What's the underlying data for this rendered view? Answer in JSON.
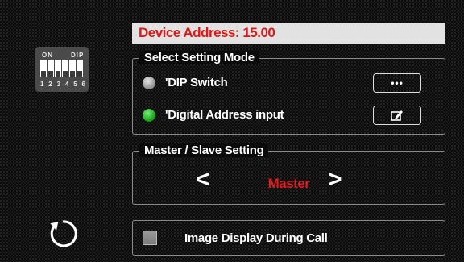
{
  "dip_widget": {
    "on_label": "ON",
    "dip_label": "DIP",
    "switch_numbers": [
      "1",
      "2",
      "3",
      "4",
      "5",
      "6"
    ]
  },
  "device_address": {
    "label": "Device Address:",
    "value": "15.00",
    "text": "Device Address:  15.00"
  },
  "setting_mode": {
    "legend": "Select Setting Mode",
    "options": [
      {
        "label": "'DIP Switch",
        "selected": false,
        "button_glyph": "•••",
        "button_icon": "more-icon"
      },
      {
        "label": "'Digital Address input",
        "selected": true,
        "button_glyph": "",
        "button_icon": "edit-icon"
      }
    ]
  },
  "master_slave": {
    "legend": "Master / Slave Setting",
    "value": "Master",
    "prev_glyph": "<",
    "next_glyph": ">"
  },
  "image_display": {
    "label": "Image Display During Call",
    "checked": false
  },
  "back_icon": "refresh-back-icon",
  "colors": {
    "accent_red": "#d81a1a",
    "selected_green": "#1aa81a",
    "address_bar_bg": "#e2e2e2"
  }
}
